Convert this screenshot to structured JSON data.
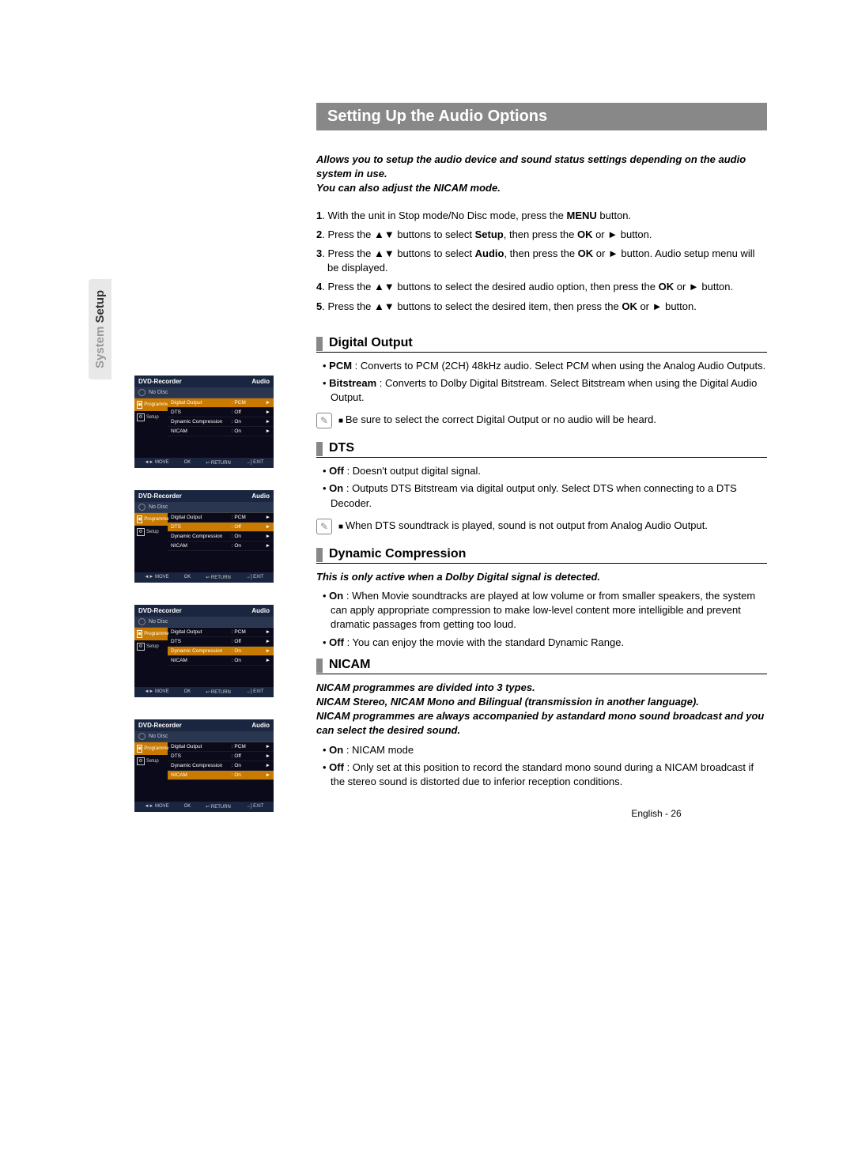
{
  "side_tab": {
    "light": "System",
    "dark": "Setup"
  },
  "title": "Setting Up the Audio Options",
  "intro": "Allows you to setup the audio device and sound status settings depending on the audio system in use.\nYou can also adjust the NICAM mode.",
  "steps": {
    "s1a": "1",
    "s1b": ". With the unit in Stop mode/No Disc mode, press the ",
    "s1c": "MENU",
    "s1d": " button.",
    "s2a": "2",
    "s2b": ". Press the ▲▼ buttons to select ",
    "s2c": "Setup",
    "s2d": ", then press the ",
    "s2e": "OK",
    "s2f": " or ► button.",
    "s3a": "3",
    "s3b": ". Press the ▲▼ buttons to select ",
    "s3c": "Audio",
    "s3d": ", then press the ",
    "s3e": "OK",
    "s3f": " or ► button. Audio setup menu will be displayed.",
    "s4a": "4",
    "s4b": ". Press the ▲▼ buttons to select the desired audio option, then press the ",
    "s4c": "OK",
    "s4d": " or ► button.",
    "s5a": "5",
    "s5b": ". Press the ▲▼ buttons to select the desired item, then press the ",
    "s5c": "OK",
    "s5d": " or ► button."
  },
  "digital": {
    "h": "Digital Output",
    "b1a": "• ",
    "b1b": "PCM",
    "b1c": " : Converts to PCM (2CH) 48kHz audio. Select PCM when using the Analog Audio Outputs.",
    "b2a": "• ",
    "b2b": "Bitstream",
    "b2c": " : Converts to Dolby Digital Bitstream. Select Bitstream when using the Digital Audio Output.",
    "note": "Be sure to select the correct Digital Output or no audio will be heard."
  },
  "dts": {
    "h": "DTS",
    "b1a": "• ",
    "b1b": "Off",
    "b1c": " : Doesn't output digital signal.",
    "b2a": "• ",
    "b2b": "On",
    "b2c": " : Outputs DTS Bitstream via digital output only. Select DTS when connecting to a DTS Decoder.",
    "note": "When DTS soundtrack is played, sound is not output from Analog Audio Output."
  },
  "dyn": {
    "h": "Dynamic Compression",
    "sub": "This is only active when a Dolby Digital signal is detected.",
    "b1a": "• ",
    "b1b": "On",
    "b1c": " : When Movie soundtracks are played at low volume or from smaller speakers, the system can apply appropriate compression to make low-level content more intelligible and prevent dramatic passages from getting too loud.",
    "b2a": "• ",
    "b2b": "Off",
    "b2c": " : You can enjoy the movie with the standard Dynamic Range."
  },
  "nicam": {
    "h": "NICAM",
    "sub": "NICAM programmes are divided into 3 types.\nNICAM Stereo, NICAM Mono and Bilingual (transmission in another language).\nNICAM programmes are always accompanied by astandard mono sound broadcast and you can select the desired sound.",
    "b1a": "• ",
    "b1b": "On",
    "b1c": " : NICAM mode",
    "b2a": "• ",
    "b2b": "Off",
    "b2c": " : Only set at this position to record the standard mono sound during a NICAM broadcast if the stereo sound is distorted due to inferior reception conditions."
  },
  "footer": "English - 26",
  "osd": {
    "head_l": "DVD-Recorder",
    "head_r": "Audio",
    "nodisc": "No Disc",
    "side_prog": "Programme",
    "side_setup": "Setup",
    "rows": {
      "r1l": "Digital Output",
      "r1v": ": PCM",
      "r2l": "DTS",
      "r2v": ": Off",
      "r3l": "Dynamic Compression",
      "r3v": ": On",
      "r4l": "NICAM",
      "r4v": ": On"
    },
    "foot": {
      "move": "◄► MOVE",
      "ok": "OK",
      "ret": "↩ RETURN",
      "exit": "→] EXIT"
    }
  }
}
